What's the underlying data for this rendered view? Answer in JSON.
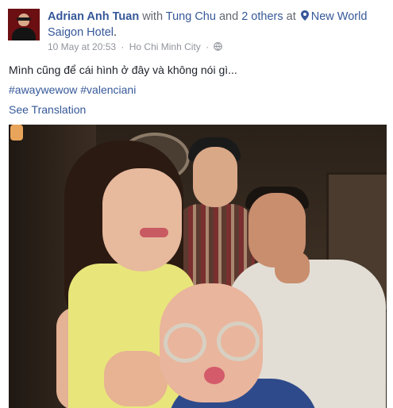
{
  "post": {
    "author": "Adrian Anh Tuan",
    "with_word": "with",
    "tagged_friend": "Tung Chu",
    "and_word": "and",
    "others": "2 others",
    "at_word": "at",
    "location_line1": "New World",
    "location_line2": "Saigon Hotel",
    "period": ".",
    "date": "10 May at 20:53",
    "separator": "·",
    "city": "Ho Chi Minh City",
    "body_text": "Mình cũng để cái hình ở đây và không nói gì...",
    "hashtags": [
      "#awaywewow",
      "#valenciani"
    ],
    "see_translation": "See Translation"
  },
  "icons": {
    "location": "map-pin-icon",
    "privacy": "globe-icon"
  },
  "colors": {
    "link": "#365899",
    "text": "#1d2129",
    "meta": "#90949c"
  }
}
